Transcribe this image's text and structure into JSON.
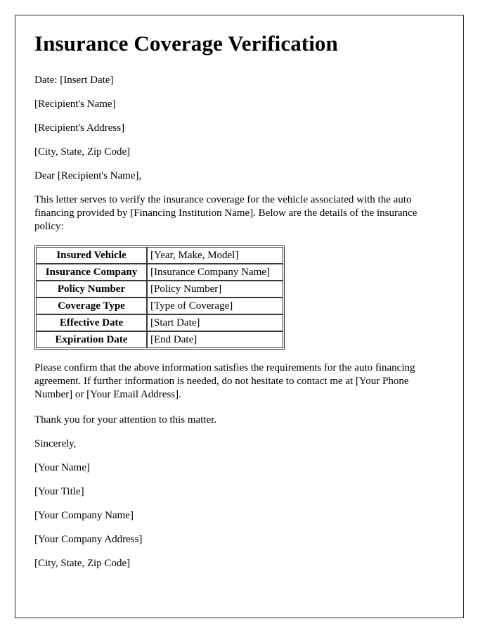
{
  "document": {
    "title": "Insurance Coverage Verification",
    "date_line": "Date: [Insert Date]",
    "recipient_name": "[Recipient's Name]",
    "recipient_address": "[Recipient's Address]",
    "recipient_city_state_zip": "[City, State, Zip Code]",
    "salutation": "Dear [Recipient's Name],",
    "intro_paragraph": "This letter serves to verify the insurance coverage for the vehicle associated with the auto financing provided by [Financing Institution Name]. Below are the details of the insurance policy:",
    "closing_paragraph": "Please confirm that the above information satisfies the requirements for the auto financing agreement. If further information is needed, do not hesitate to contact me at [Your Phone Number] or [Your Email Address].",
    "thanks_paragraph": "Thank you for your attention to this matter.",
    "sign_off": "Sincerely,",
    "signature": {
      "your_name": "[Your Name]",
      "your_title": "[Your Title]",
      "your_company_name": "[Your Company Name]",
      "your_company_address": "[Your Company Address]",
      "your_city_state_zip": "[City, State, Zip Code]"
    },
    "policy_table": {
      "rows": [
        {
          "label": "Insured Vehicle",
          "value": "[Year, Make, Model]"
        },
        {
          "label": "Insurance Company",
          "value": "[Insurance Company Name]"
        },
        {
          "label": "Policy Number",
          "value": "[Policy Number]"
        },
        {
          "label": "Coverage Type",
          "value": "[Type of Coverage]"
        },
        {
          "label": "Effective Date",
          "value": "[Start Date]"
        },
        {
          "label": "Expiration Date",
          "value": "[End Date]"
        }
      ]
    }
  }
}
